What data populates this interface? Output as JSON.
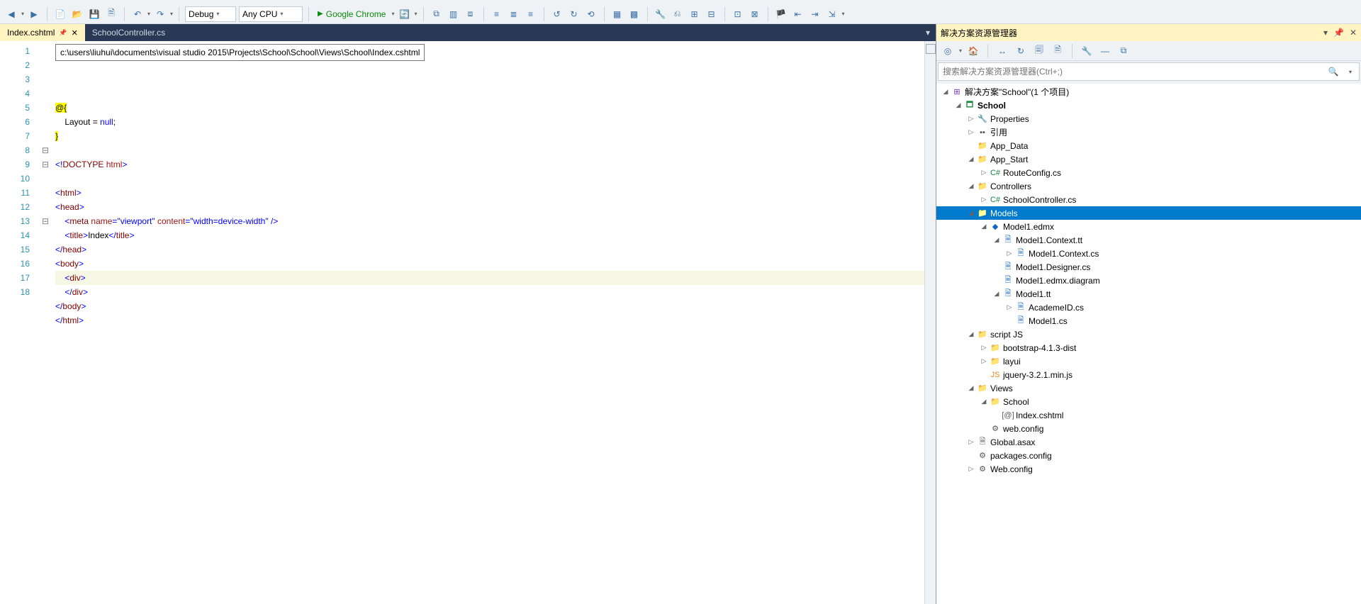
{
  "toolbar": {
    "config": "Debug",
    "platform": "Any CPU",
    "run_target": "Google Chrome"
  },
  "tabs": [
    {
      "name": "Index.cshtml",
      "active": true,
      "pinned": true
    },
    {
      "name": "SchoolController.cs",
      "active": false,
      "pinned": false
    }
  ],
  "tooltip_path": "c:\\users\\liuhui\\documents\\visual studio 2015\\Projects\\School\\School\\Views\\School\\Index.cshtml",
  "code_lines": [
    {
      "n": 1,
      "fold": "",
      "html": ""
    },
    {
      "n": 2,
      "fold": "",
      "html": "<span class='cc-bgyel cc-black'>@{</span>"
    },
    {
      "n": 3,
      "fold": "",
      "html": "    Layout = <span class='cc-blue'>null</span>;"
    },
    {
      "n": 4,
      "fold": "",
      "html": "<span class='cc-bgyel cc-black'>}</span>"
    },
    {
      "n": 5,
      "fold": "",
      "html": ""
    },
    {
      "n": 6,
      "fold": "",
      "html": "<span class='cc-blue'>&lt;!</span><span class='cc-brown'>DOCTYPE</span> <span class='cc-red'>html</span><span class='cc-blue'>&gt;</span>"
    },
    {
      "n": 7,
      "fold": "",
      "html": ""
    },
    {
      "n": 8,
      "fold": "⊟",
      "html": "<span class='cc-blue'>&lt;</span><span class='cc-brown'>html</span><span class='cc-blue'>&gt;</span>"
    },
    {
      "n": 9,
      "fold": "⊟",
      "html": "<span class='cc-blue'>&lt;</span><span class='cc-brown'>head</span><span class='cc-blue'>&gt;</span>"
    },
    {
      "n": 10,
      "fold": "",
      "html": "    <span class='cc-blue'>&lt;</span><span class='cc-brown'>meta</span> <span class='cc-red'>name</span><span class='cc-blue'>=\"viewport\"</span> <span class='cc-red'>content</span><span class='cc-blue'>=\"width=device-width\" /&gt;</span>"
    },
    {
      "n": 11,
      "fold": "",
      "html": "    <span class='cc-blue'>&lt;</span><span class='cc-brown'>title</span><span class='cc-blue'>&gt;</span>Index<span class='cc-blue'>&lt;/</span><span class='cc-brown'>title</span><span class='cc-blue'>&gt;</span>"
    },
    {
      "n": 12,
      "fold": "",
      "html": "<span class='cc-blue'>&lt;/</span><span class='cc-brown'>head</span><span class='cc-blue'>&gt;</span>"
    },
    {
      "n": 13,
      "fold": "⊟",
      "html": "<span class='cc-blue'>&lt;</span><span class='cc-brown'>body</span><span class='cc-blue'>&gt;</span>"
    },
    {
      "n": 14,
      "fold": "",
      "html": "    <span class='cc-blue'>&lt;</span><span class='cc-brown'>div</span><span class='cc-blue'>&gt;</span>",
      "hl": true
    },
    {
      "n": 15,
      "fold": "",
      "html": "    <span class='cc-blue'>&lt;/</span><span class='cc-brown'>div</span><span class='cc-blue'>&gt;</span>"
    },
    {
      "n": 16,
      "fold": "",
      "html": "<span class='cc-blue'>&lt;/</span><span class='cc-brown'>body</span><span class='cc-blue'>&gt;</span>"
    },
    {
      "n": 17,
      "fold": "",
      "html": "<span class='cc-blue'>&lt;/</span><span class='cc-brown'>html</span><span class='cc-blue'>&gt;</span>"
    },
    {
      "n": 18,
      "fold": "",
      "html": ""
    }
  ],
  "solution_explorer": {
    "title": "解决方案资源管理器",
    "search_placeholder": "搜索解决方案资源管理器(Ctrl+;)",
    "root": "解决方案\"School\"(1 个项目)",
    "tree": [
      {
        "d": 0,
        "tw": "◢",
        "ic": "sln",
        "lbl": "解决方案\"School\"(1 个项目)"
      },
      {
        "d": 1,
        "tw": "◢",
        "ic": "proj",
        "lbl": "School",
        "bold": true
      },
      {
        "d": 2,
        "tw": "▷",
        "ic": "wrench",
        "lbl": "Properties"
      },
      {
        "d": 2,
        "tw": "▷",
        "ic": "ref",
        "lbl": "引用"
      },
      {
        "d": 2,
        "tw": "",
        "ic": "folder",
        "lbl": "App_Data"
      },
      {
        "d": 2,
        "tw": "◢",
        "ic": "folder",
        "lbl": "App_Start"
      },
      {
        "d": 3,
        "tw": "▷",
        "ic": "cs",
        "lbl": "RouteConfig.cs"
      },
      {
        "d": 2,
        "tw": "◢",
        "ic": "folder",
        "lbl": "Controllers"
      },
      {
        "d": 3,
        "tw": "▷",
        "ic": "cs",
        "lbl": "SchoolController.cs"
      },
      {
        "d": 2,
        "tw": "◢",
        "ic": "folder",
        "lbl": "Models",
        "sel": true
      },
      {
        "d": 3,
        "tw": "◢",
        "ic": "edmx",
        "lbl": "Model1.edmx"
      },
      {
        "d": 4,
        "tw": "◢",
        "ic": "tt",
        "lbl": "Model1.Context.tt"
      },
      {
        "d": 5,
        "tw": "▷",
        "ic": "tt",
        "lbl": "Model1.Context.cs"
      },
      {
        "d": 4,
        "tw": "",
        "ic": "tt",
        "lbl": "Model1.Designer.cs"
      },
      {
        "d": 4,
        "tw": "",
        "ic": "tt",
        "lbl": "Model1.edmx.diagram"
      },
      {
        "d": 4,
        "tw": "◢",
        "ic": "tt",
        "lbl": "Model1.tt"
      },
      {
        "d": 5,
        "tw": "▷",
        "ic": "tt",
        "lbl": "AcademeID.cs"
      },
      {
        "d": 5,
        "tw": "",
        "ic": "tt",
        "lbl": "Model1.cs"
      },
      {
        "d": 2,
        "tw": "◢",
        "ic": "folder",
        "lbl": "script JS"
      },
      {
        "d": 3,
        "tw": "▷",
        "ic": "folder",
        "lbl": "bootstrap-4.1.3-dist"
      },
      {
        "d": 3,
        "tw": "▷",
        "ic": "folder",
        "lbl": "layui"
      },
      {
        "d": 3,
        "tw": "",
        "ic": "js",
        "lbl": "jquery-3.2.1.min.js"
      },
      {
        "d": 2,
        "tw": "◢",
        "ic": "folder",
        "lbl": "Views"
      },
      {
        "d": 3,
        "tw": "◢",
        "ic": "folder",
        "lbl": "School"
      },
      {
        "d": 4,
        "tw": "",
        "ic": "view",
        "lbl": "Index.cshtml"
      },
      {
        "d": 3,
        "tw": "",
        "ic": "cfg",
        "lbl": "web.config"
      },
      {
        "d": 2,
        "tw": "▷",
        "ic": "asax",
        "lbl": "Global.asax"
      },
      {
        "d": 2,
        "tw": "",
        "ic": "cfg",
        "lbl": "packages.config"
      },
      {
        "d": 2,
        "tw": "▷",
        "ic": "cfg",
        "lbl": "Web.config"
      }
    ]
  }
}
